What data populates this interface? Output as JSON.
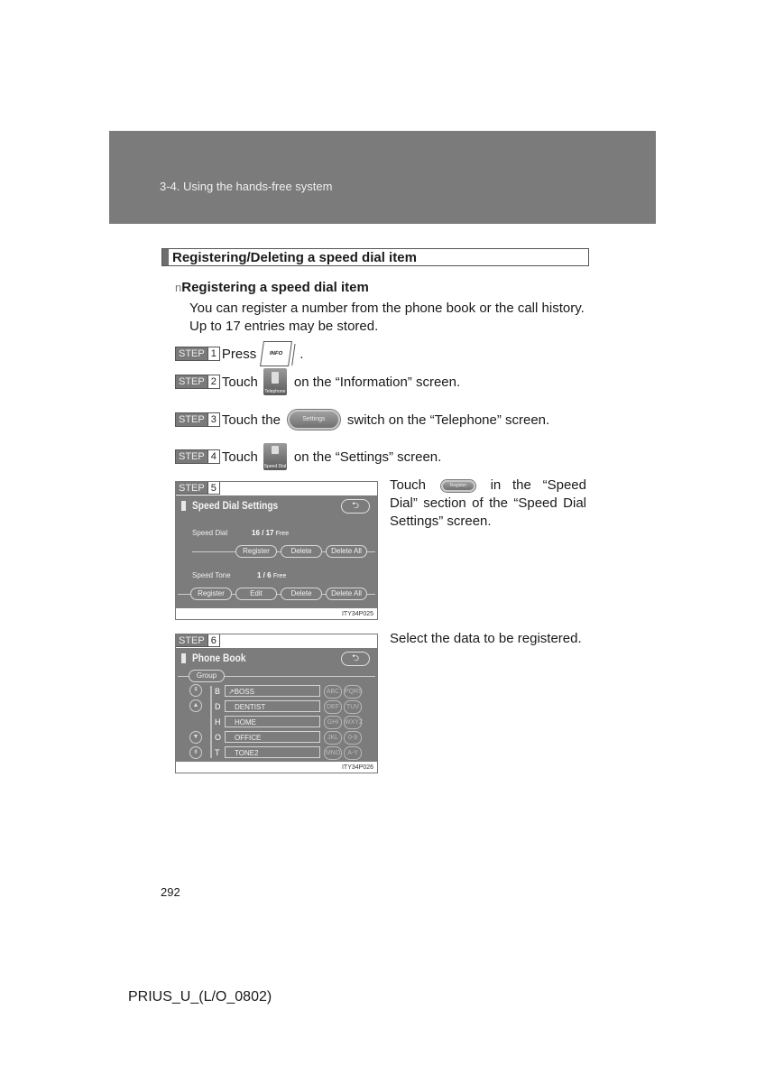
{
  "header": {
    "chapter": "3-4. Using the hands-free system"
  },
  "section": {
    "title": "Registering/Deleting a speed dial item"
  },
  "subsection": {
    "bullet": "n",
    "title": "Registering a speed dial item"
  },
  "intro": {
    "line1": "You can register a number from the phone book or the call history.",
    "line2": "Up to 17 entries may be stored."
  },
  "step_label": "STEP",
  "steps": [
    {
      "num": "1",
      "pre": "Press",
      "icon": "INFO",
      "post": "."
    },
    {
      "num": "2",
      "pre": "Touch",
      "icon": "Telephone",
      "post": "on the “Information” screen."
    },
    {
      "num": "3",
      "pre": "Touch the",
      "icon": "Settings",
      "post": "switch on the “Telephone” screen."
    },
    {
      "num": "4",
      "pre": "Touch",
      "icon": "Speed Dial",
      "post": "on the “Settings” screen."
    },
    {
      "num": "5"
    },
    {
      "num": "6"
    }
  ],
  "step5_desc": {
    "pre": "Touch",
    "icon": "Register",
    "post": "in the “Speed Dial” section of the “Speed Dial Settings” screen."
  },
  "step6_desc": "Select the data to be registered.",
  "speed_dial_screen": {
    "title": "Speed Dial Settings",
    "back": "⮌",
    "speed_dial_label": "Speed Dial",
    "speed_dial_count": "16 / 17",
    "free": "Free",
    "speed_dial_buttons": [
      "Register",
      "Delete",
      "Delete All"
    ],
    "speed_tone_label": "Speed Tone",
    "speed_tone_count": "1 /  6",
    "speed_tone_buttons": [
      "Register",
      "Edit",
      "Delete",
      "Delete All"
    ],
    "figure_code": "ITY34P025"
  },
  "phone_book_screen": {
    "title": "Phone Book",
    "back": "⮌",
    "group": "Group",
    "entries": [
      {
        "letter": "B",
        "name": "↗BOSS"
      },
      {
        "letter": "D",
        "name": "DENTIST"
      },
      {
        "letter": "H",
        "name": "HOME"
      },
      {
        "letter": "O",
        "name": "OFFICE"
      },
      {
        "letter": "T",
        "name": "TONE2"
      }
    ],
    "alpha_keys": [
      [
        "ABC",
        "PQRS"
      ],
      [
        "DEF",
        "TUV"
      ],
      [
        "GHI",
        "WXYZ"
      ],
      [
        "JKL",
        "0-9"
      ],
      [
        "MNO",
        "A-Y"
      ]
    ],
    "scroll_keys": [
      "⇞",
      "▲",
      "▼",
      "⇟"
    ],
    "figure_code": "ITY34P026"
  },
  "page_number": "292",
  "footer": "PRIUS_U_(L/O_0802)"
}
